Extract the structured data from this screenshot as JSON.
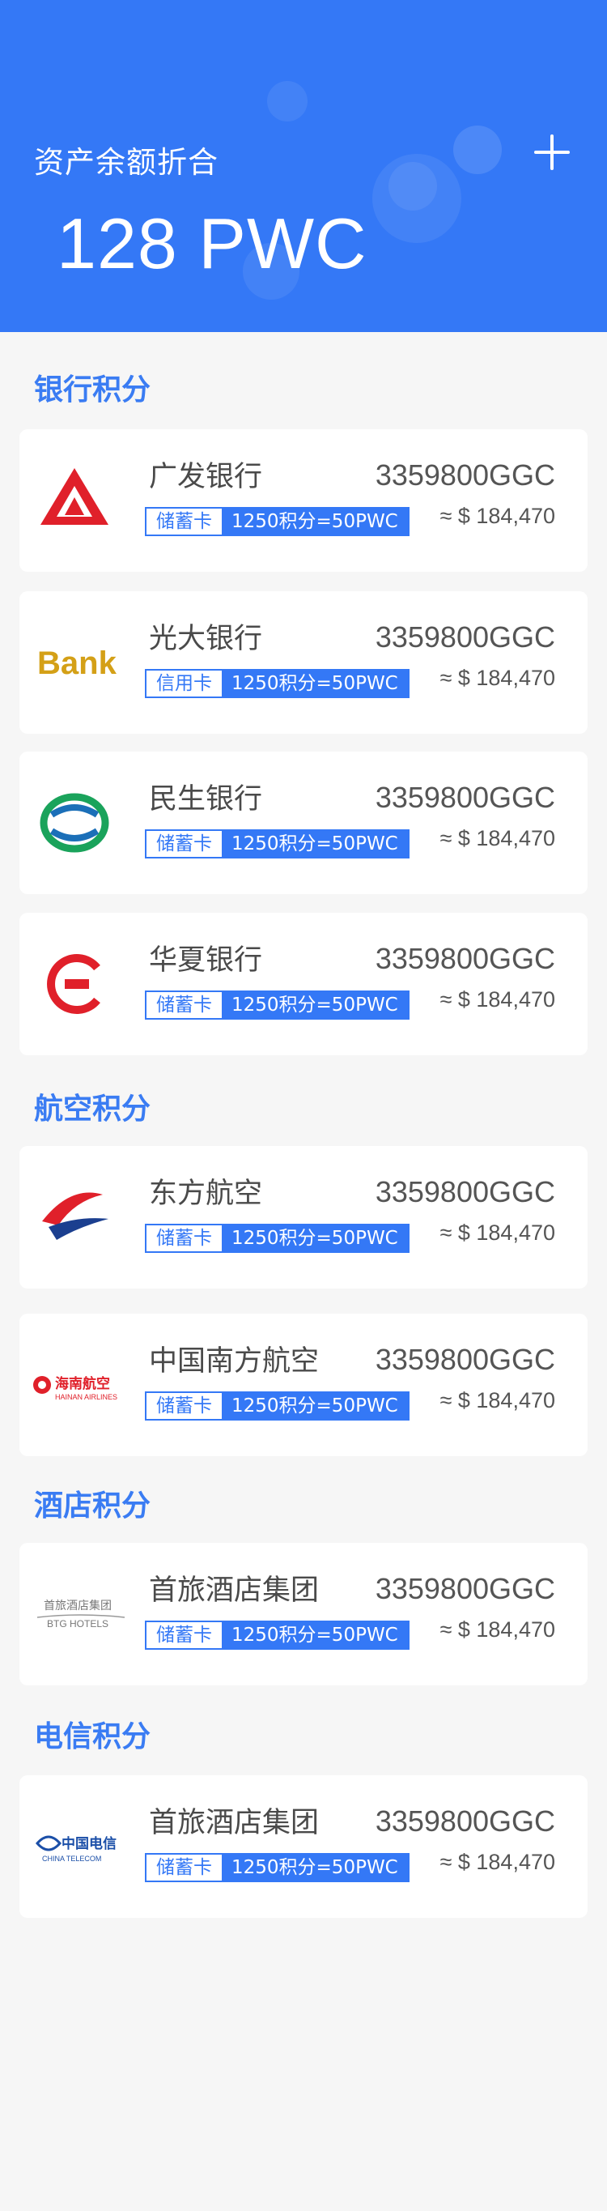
{
  "header": {
    "title": "资产余额折合",
    "amount": "128 PWC",
    "background_color": "#3478f6"
  },
  "sections": [
    {
      "title": "银行积分",
      "cards": [
        {
          "name": "广发银行",
          "card_type": "储蓄卡",
          "rate": "1250积分=50PWC",
          "points": "3359800GGC",
          "fiat": "≈ $ 184,470",
          "logo": "cgb-bank-logo"
        },
        {
          "name": "光大银行",
          "card_type": "信用卡",
          "rate": "1250积分=50PWC",
          "points": "3359800GGC",
          "fiat": "≈ $ 184,470",
          "logo": "ceb-bank-logo",
          "logo_text": "Bank"
        },
        {
          "name": "民生银行",
          "card_type": "储蓄卡",
          "rate": "1250积分=50PWC",
          "points": "3359800GGC",
          "fiat": "≈ $ 184,470",
          "logo": "cmbc-bank-logo"
        },
        {
          "name": "华夏银行",
          "card_type": "储蓄卡",
          "rate": "1250积分=50PWC",
          "points": "3359800GGC",
          "fiat": "≈ $ 184,470",
          "logo": "hxb-bank-logo"
        }
      ]
    },
    {
      "title": "航空积分",
      "cards": [
        {
          "name": "东方航空",
          "card_type": "储蓄卡",
          "rate": "1250积分=50PWC",
          "points": "3359800GGC",
          "fiat": "≈ $ 184,470",
          "logo": "china-eastern-logo"
        },
        {
          "name": "中国南方航空",
          "card_type": "储蓄卡",
          "rate": "1250积分=50PWC",
          "points": "3359800GGC",
          "fiat": "≈ $ 184,470",
          "logo": "hainan-airlines-logo",
          "logo_text": "海南航空",
          "logo_sub": "HAINAN AIRLINES"
        }
      ]
    },
    {
      "title": "酒店积分",
      "cards": [
        {
          "name": "首旅酒店集团",
          "card_type": "储蓄卡",
          "rate": "1250积分=50PWC",
          "points": "3359800GGC",
          "fiat": "≈ $ 184,470",
          "logo": "btg-hotels-logo",
          "logo_text": "首旅酒店集团",
          "logo_sub": "BTG HOTELS"
        }
      ]
    },
    {
      "title": "电信积分",
      "cards": [
        {
          "name": "首旅酒店集团",
          "card_type": "储蓄卡",
          "rate": "1250积分=50PWC",
          "points": "3359800GGC",
          "fiat": "≈ $ 184,470",
          "logo": "china-telecom-logo",
          "logo_text": "中国电信",
          "logo_sub": "CHINA TELECOM"
        }
      ]
    }
  ]
}
